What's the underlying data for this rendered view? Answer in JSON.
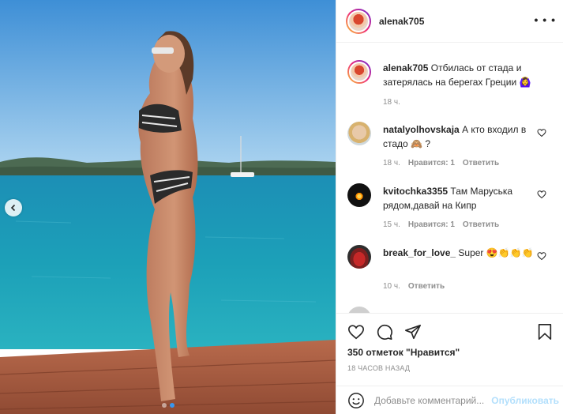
{
  "post": {
    "username": "alenak705",
    "more_icon": "more-horizontal-icon"
  },
  "caption": {
    "username": "alenak705",
    "text": "Отбилась от стада и затерялась на берегах Греции 🙆‍♀️",
    "time": "18 ч."
  },
  "comments": [
    {
      "username": "natalyolhovskaja",
      "text": "А кто входил в стадо 🙈 ?",
      "time": "18 ч.",
      "likes": "Нравится: 1",
      "reply": "Ответить"
    },
    {
      "username": "kvitochka3355",
      "text": "Там Маруська рядом,давай на Кипр",
      "time": "15 ч.",
      "likes": "Нравится: 1",
      "reply": "Ответить"
    },
    {
      "username": "break_for_love_",
      "text": "Super 😍👏👏👏",
      "time": "10 ч.",
      "likes": "",
      "reply": "Ответить"
    },
    {
      "username": "",
      "text": "",
      "time": "",
      "likes": "",
      "reply": ""
    }
  ],
  "likes_text": "350 отметок \"Нравится\"",
  "timestamp": "18 ЧАСОВ НАЗАД",
  "comment_box": {
    "placeholder": "Добавьте комментарий...",
    "publish_label": "Опубликовать"
  },
  "carousel": {
    "current": 1,
    "total": 2
  },
  "colors": {
    "accent": "#3897f0",
    "publish_disabled": "#b2dffc",
    "muted": "#8e8e8e"
  }
}
